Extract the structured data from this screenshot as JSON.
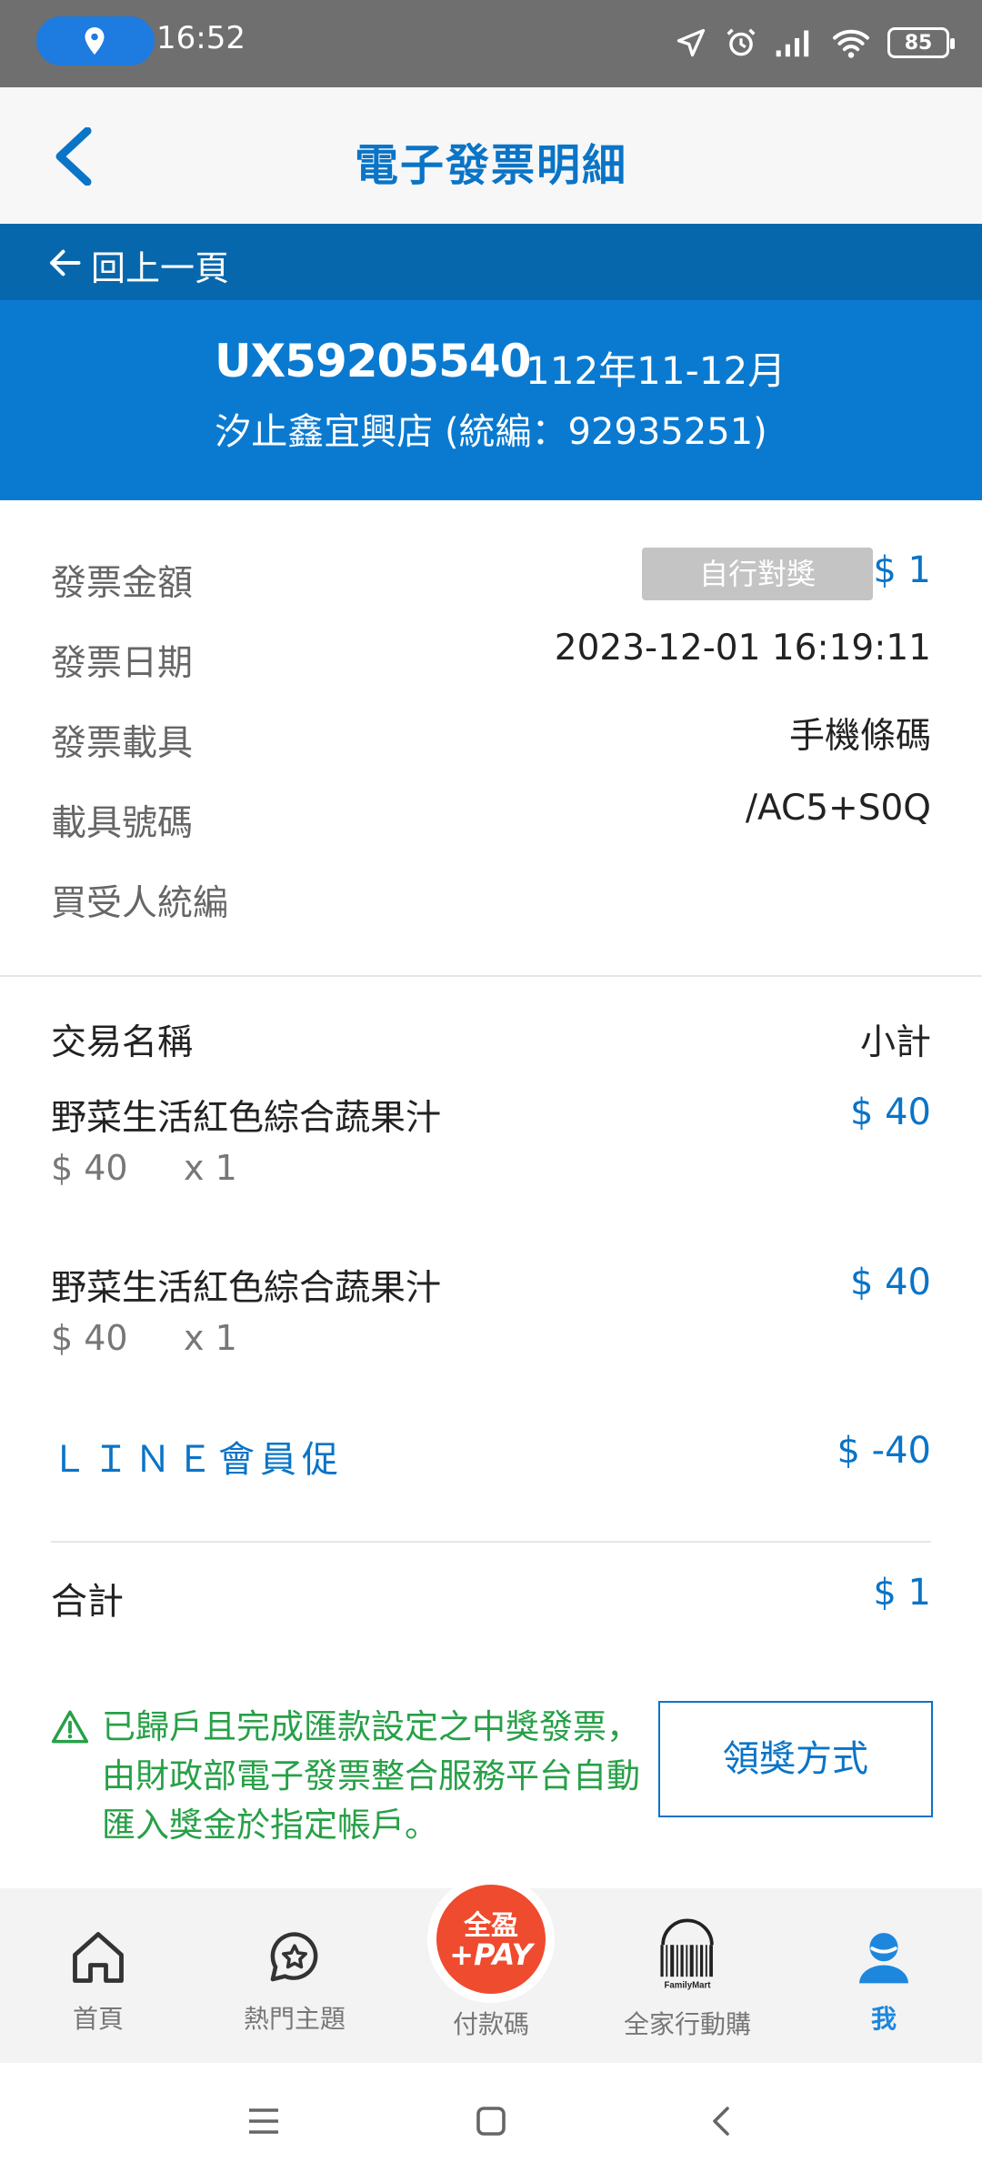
{
  "status_bar": {
    "time": "16:52",
    "battery": "85",
    "icons": [
      "location-pin-icon",
      "navigation-icon",
      "alarm-icon",
      "signal-icon",
      "wifi-icon",
      "battery-icon"
    ]
  },
  "header": {
    "title": "電子發票明細",
    "back_icon": "chevron-left-icon"
  },
  "back_bar": {
    "label": "回上一頁"
  },
  "summary": {
    "invoice_number": "UX59205540",
    "period": "112年11-12月",
    "store": "汐止鑫宜興店 (統編：92935251)"
  },
  "info": {
    "amount_label": "發票金額",
    "badge": "自行對獎",
    "amount": "$ 1",
    "date_label": "發票日期",
    "date": "2023-12-01 16:19:11",
    "carrier_label": "發票載具",
    "carrier": "手機條碼",
    "carrier_no_label": "載具號碼",
    "carrier_no": "/AC5+S0Q",
    "buyer_label": "買受人統編",
    "buyer": ""
  },
  "items": {
    "col_name": "交易名稱",
    "col_subtotal": "小計",
    "list": [
      {
        "name": "野菜生活紅色綜合蔬果汁",
        "price": "$ 40",
        "qty": "x 1",
        "subtotal": "$ 40"
      },
      {
        "name": "野菜生活紅色綜合蔬果汁",
        "price": "$ 40",
        "qty": "x 1",
        "subtotal": "$ 40"
      }
    ],
    "promo": {
      "name": "ＬＩＮＥ會員促",
      "subtotal": "$ -40"
    },
    "total_label": "合計",
    "total": "$ 1"
  },
  "notice": {
    "text": "已歸戶且完成匯款設定之中獎發票，由財政部電子發票整合服務平台自動匯入獎金於指定帳戶。",
    "button": "領獎方式"
  },
  "bottom_nav": {
    "items": [
      {
        "label": "首頁",
        "icon": "home-icon"
      },
      {
        "label": "熱門主題",
        "icon": "star-chat-icon"
      },
      {
        "label": "付款碼",
        "icon": "pay-icon"
      },
      {
        "label": "全家行動購",
        "icon": "familymart-barcode-icon"
      },
      {
        "label": "我",
        "icon": "user-icon"
      }
    ],
    "pay_logo_line1": "全盈",
    "pay_logo_line2": "+PAY",
    "barcode_brand": "FamilyMart"
  },
  "colors": {
    "brand_blue": "#0a7ad0",
    "dark_blue": "#0767ad",
    "link_blue": "#0a74c7",
    "notice_green": "#27a047",
    "pay_red": "#ef4b2e"
  }
}
